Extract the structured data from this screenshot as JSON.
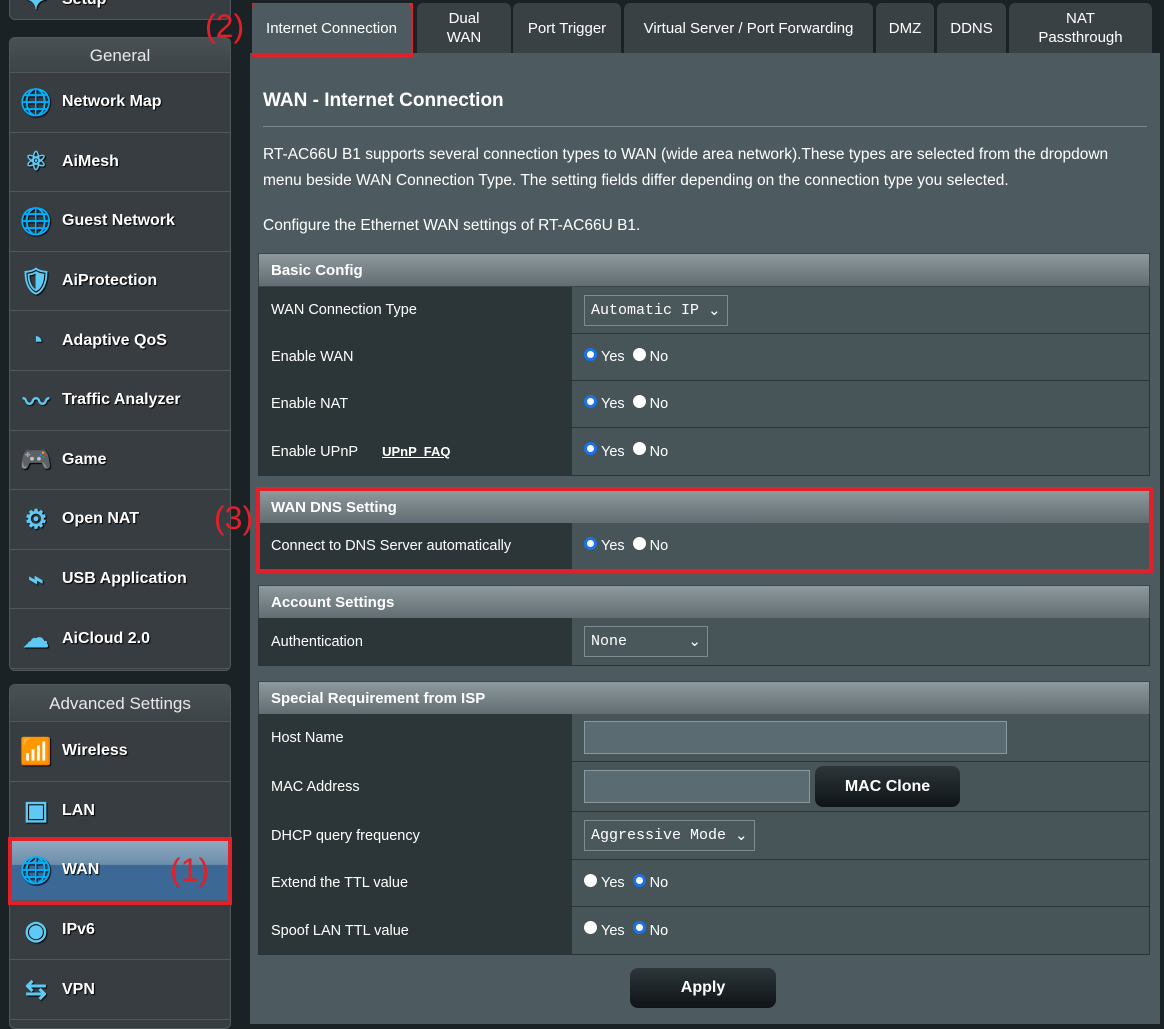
{
  "sidebar": {
    "setup_label": "Setup",
    "general": {
      "title": "General",
      "items": [
        {
          "label": "Network Map",
          "icon": "globe-pin-icon"
        },
        {
          "label": "AiMesh",
          "icon": "mesh-icon"
        },
        {
          "label": "Guest Network",
          "icon": "guest-globe-icon"
        },
        {
          "label": "AiProtection",
          "icon": "shield-lock-icon"
        },
        {
          "label": "Adaptive QoS",
          "icon": "gauge-icon"
        },
        {
          "label": "Traffic Analyzer",
          "icon": "traffic-icon"
        },
        {
          "label": "Game",
          "icon": "gamepad-icon"
        },
        {
          "label": "Open NAT",
          "icon": "open-nat-icon"
        },
        {
          "label": "USB Application",
          "icon": "usb-icon"
        },
        {
          "label": "AiCloud 2.0",
          "icon": "cloud-icon"
        }
      ]
    },
    "advanced": {
      "title": "Advanced Settings",
      "items": [
        {
          "label": "Wireless",
          "icon": "wifi-icon"
        },
        {
          "label": "LAN",
          "icon": "lan-port-icon"
        },
        {
          "label": "WAN",
          "icon": "globe-icon",
          "active": true
        },
        {
          "label": "IPv6",
          "icon": "ipv6-icon"
        },
        {
          "label": "VPN",
          "icon": "vpn-monitor-icon"
        }
      ]
    }
  },
  "tabs": [
    "Internet Connection",
    "Dual WAN",
    "Port Trigger",
    "Virtual Server / Port Forwarding",
    "DMZ",
    "DDNS",
    "NAT Passthrough"
  ],
  "main": {
    "title": "WAN - Internet Connection",
    "desc1": "RT-AC66U B1 supports several connection types to WAN (wide area network).These types are selected from the dropdown",
    "desc2": "menu beside WAN Connection Type. The setting fields differ depending on the connection type you selected.",
    "desc3": "Configure the Ethernet WAN settings of RT-AC66U B1.",
    "basic": {
      "header": "Basic Config",
      "wan_type_label": "WAN Connection Type",
      "wan_type_value": "Automatic IP",
      "enable_wan": "Enable WAN",
      "enable_nat": "Enable NAT",
      "enable_upnp": "Enable UPnP",
      "upnp_faq": "UPnP  FAQ"
    },
    "dns": {
      "header": "WAN DNS Setting",
      "connect_label": "Connect to DNS Server automatically"
    },
    "account": {
      "header": "Account Settings",
      "auth_label": "Authentication",
      "auth_value": "None"
    },
    "isp": {
      "header": "Special Requirement from ISP",
      "host_label": "Host Name",
      "host_value": "",
      "mac_label": "MAC Address",
      "mac_value": "",
      "mac_clone": "MAC Clone",
      "dhcp_label": "DHCP query frequency",
      "dhcp_value": "Aggressive Mode",
      "ttl_label": "Extend the TTL value",
      "spoof_label": "Spoof LAN TTL value"
    },
    "yes": "Yes",
    "no": "No",
    "apply": "Apply"
  },
  "annotations": {
    "a1": "(1)",
    "a2": "(2)",
    "a3": "(3)"
  },
  "colors": {
    "accent_red": "#e2202a",
    "radio_blue": "#1a73e8",
    "active_item": "#3b6894"
  }
}
